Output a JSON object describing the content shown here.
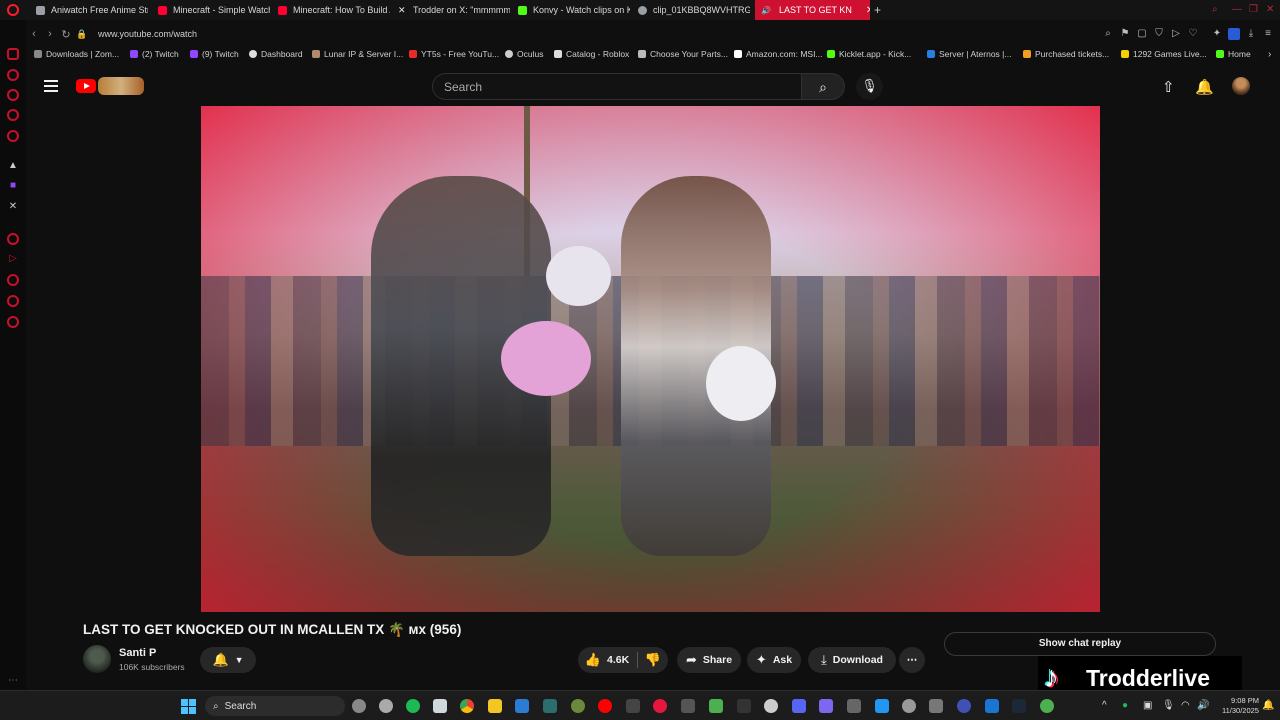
{
  "browser": {
    "tabs": [
      {
        "label": "Aniwatch Free Anime Stre",
        "icon": "aniwatch-icon",
        "color": "#9aa0a6"
      },
      {
        "label": "Minecraft - Simple Watch",
        "icon": "youtube-icon",
        "color": "#ff0033"
      },
      {
        "label": "Minecraft: How To Build A",
        "icon": "youtube-icon",
        "color": "#ff0033"
      },
      {
        "label": "Trodder on X: \"mmmmm",
        "icon": "x-icon",
        "color": "#e6e6e6"
      },
      {
        "label": "Konvy - Watch clips on K",
        "icon": "kick-icon",
        "color": "#53fc18"
      },
      {
        "label": "clip_01KBBQ8WVHTRG3",
        "icon": "clip-icon",
        "color": "#9aa0a6"
      },
      {
        "label": "LAST TO GET KN",
        "icon": "youtube-icon",
        "color": "#ffffff",
        "active": true
      }
    ],
    "new_tab": "+",
    "url": "www.youtube.com/watch",
    "bookmarks": [
      {
        "label": "Downloads | Zom..."
      },
      {
        "label": "(2) Twitch"
      },
      {
        "label": "(9) Twitch"
      },
      {
        "label": "Dashboard"
      },
      {
        "label": "Lunar IP & Server I..."
      },
      {
        "label": "YT5s - Free YouTu..."
      },
      {
        "label": "Oculus"
      },
      {
        "label": "Catalog - Roblox"
      },
      {
        "label": "Choose Your Parts..."
      },
      {
        "label": "Amazon.com: MSI..."
      },
      {
        "label": "Kicklet.app - Kick..."
      },
      {
        "label": "Server | Aternos |..."
      },
      {
        "label": "Purchased tickets..."
      },
      {
        "label": "1292 Games Live..."
      },
      {
        "label": "Home"
      }
    ]
  },
  "youtube": {
    "search_placeholder": "Search",
    "video": {
      "title": "LAST TO GET KNOCKED OUT IN MCALLEN TX 🌴 ᴍx (956)",
      "channel": "Santi P",
      "subscribers": "106K subscribers",
      "likes": "4.6K",
      "share_label": "Share",
      "ask_label": "Ask",
      "download_label": "Download",
      "more_label": "⋯"
    },
    "chat_replay": "Show chat replay"
  },
  "overlay": {
    "tiktok_handle": "Trodderlive"
  },
  "taskbar": {
    "search_label": "Search",
    "time": "9:08 PM",
    "date": "11/30/2025"
  },
  "colors": {
    "opera_red": "#cf1131",
    "youtube_red": "#ff0000",
    "background": "#0f0f0f"
  }
}
